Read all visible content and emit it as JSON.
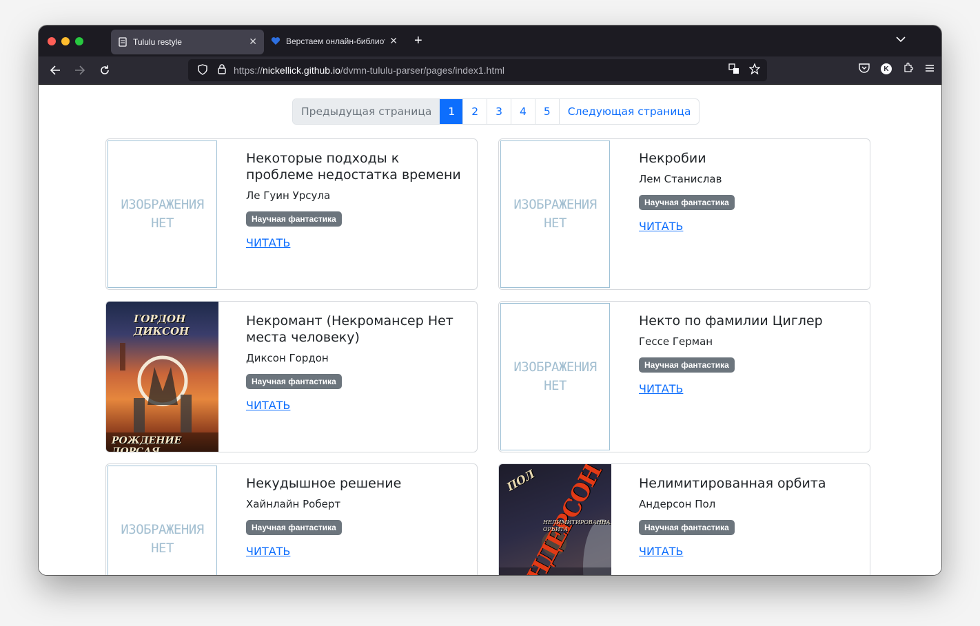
{
  "browser": {
    "tabs": [
      {
        "title": "Tululu restyle",
        "active": true
      },
      {
        "title": "Верстаем онлайн-библиотеку",
        "active": false
      }
    ],
    "url_scheme": "https://",
    "url_host": "nickellick.github.io",
    "url_path": "/dvmn-tululu-parser/pages/index1.html",
    "profile_initial": "K"
  },
  "pagination": {
    "prev_label": "Предыдущая страница",
    "pages": [
      "1",
      "2",
      "3",
      "4",
      "5"
    ],
    "active_page": "1",
    "next_label": "Следующая страница"
  },
  "no_image": {
    "line1": "ИЗОБРАЖЕНИЯ",
    "line2": "НЕТ"
  },
  "books": [
    {
      "title": "Некоторые подходы к проблеме недостатка времени",
      "author": "Ле Гуин Урсула",
      "genre": "Научная фантастика",
      "read_label": "ЧИТАТЬ",
      "has_cover": false
    },
    {
      "title": "Некробии",
      "author": "Лем Станислав",
      "genre": "Научная фантастика",
      "read_label": "ЧИТАТЬ",
      "has_cover": false
    },
    {
      "title": "Некромант (Некромансер Нет места человеку)",
      "author": "Диксон Гордон",
      "genre": "Научная фантастика",
      "read_label": "ЧИТАТЬ",
      "has_cover": true,
      "cover_text_top": "ГОРДОН ДИКСОН",
      "cover_text_bottom": "РОЖДЕНИЕ ДОРСАЯ"
    },
    {
      "title": "Некто по фамилии Циглер",
      "author": "Гессе Герман",
      "genre": "Научная фантастика",
      "read_label": "ЧИТАТЬ",
      "has_cover": false
    },
    {
      "title": "Некудышное решение",
      "author": "Хайнлайн Роберт",
      "genre": "Научная фантастика",
      "read_label": "ЧИТАТЬ",
      "has_cover": false
    },
    {
      "title": "Нелимитированная орбита",
      "author": "Андерсон Пол",
      "genre": "Научная фантастика",
      "read_label": "ЧИТАТЬ",
      "has_cover": true,
      "cover_text_top": "ПОЛ",
      "cover_text_bottom": "АНДЕРСОН",
      "cover_subtitle": "НЕЛИМИТИРОВАННАЯ ОРБИТА"
    }
  ],
  "colors": {
    "link": "#0d6efd",
    "badge": "#6c757d",
    "tabbar": "#1c1b22",
    "navbar": "#2b2a33"
  }
}
